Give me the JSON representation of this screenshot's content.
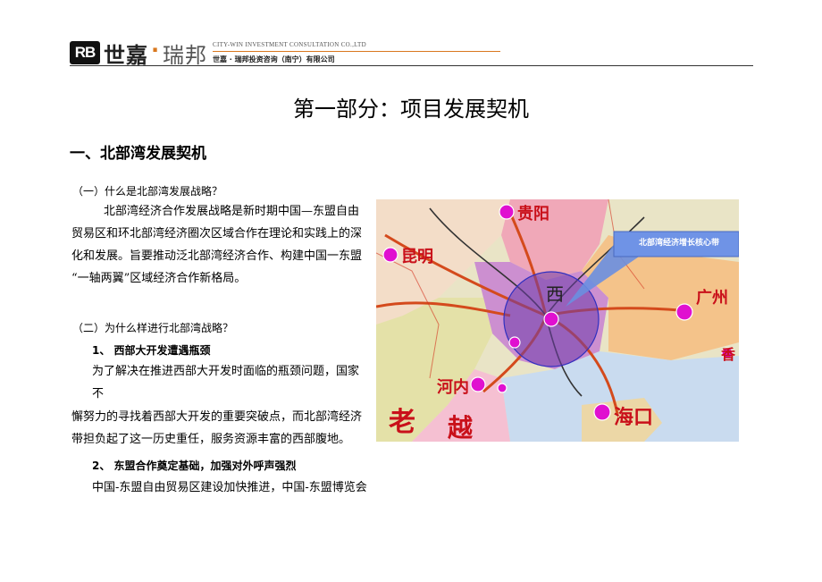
{
  "header": {
    "logo_badge": "RB",
    "logo_cn_1": "世嘉",
    "logo_dot": "·",
    "logo_cn_2": "瑞邦",
    "logo_en": "CITY-WIN INVESTMENT CONSULTATION CO.,LTD",
    "logo_sub": "世嘉 · 瑞邦投资咨询（南宁）有限公司"
  },
  "page_title": "第一部分：项目发展契机",
  "section_heading": "一、北部湾发展契机",
  "q1": {
    "title": "（一）什么是北部湾发展战略？",
    "lines": [
      "北部湾经济合作发展战略是新时期中国—东盟自由",
      "贸易区和环北部湾经济圈次区域合作在理论和实践上的深",
      "化和发展。旨要推动泛北部湾经济合作、构建中国一东盟",
      "“一轴两翼”区域经济合作新格局。"
    ]
  },
  "q2": {
    "title": "（二）为什么样进行北部湾战略？",
    "point1_title": "1、 西部大开发遭遇瓶颈",
    "point1_lines": [
      "为了解决在推进西部大开发时面临的瓶颈问题，国家",
      "不",
      "懈努力的寻找着西部大开发的重要突破点，而北部湾经济",
      "带担负起了这一历史重任，服务资源丰富的西部腹地。"
    ],
    "point2_title": "2、 东盟合作奠定基础，加强对外呼声强烈",
    "point2_lines": [
      "中国-东盟自由贸易区建设加快推进，中国-东盟博览会"
    ]
  },
  "map": {
    "callout": "北部湾经济增长核心带",
    "cities": {
      "guiyang": "贵阳",
      "kunming": "昆明",
      "guangzhou": "广州",
      "hanoi": "河内",
      "haikou": "海口",
      "xi": "西",
      "lao": "老",
      "yue": "越",
      "xiang": "香"
    },
    "colors": {
      "city_dot": "#e010d0",
      "callout_bg": "#6a8fe0",
      "circle": "#3030c0"
    }
  }
}
